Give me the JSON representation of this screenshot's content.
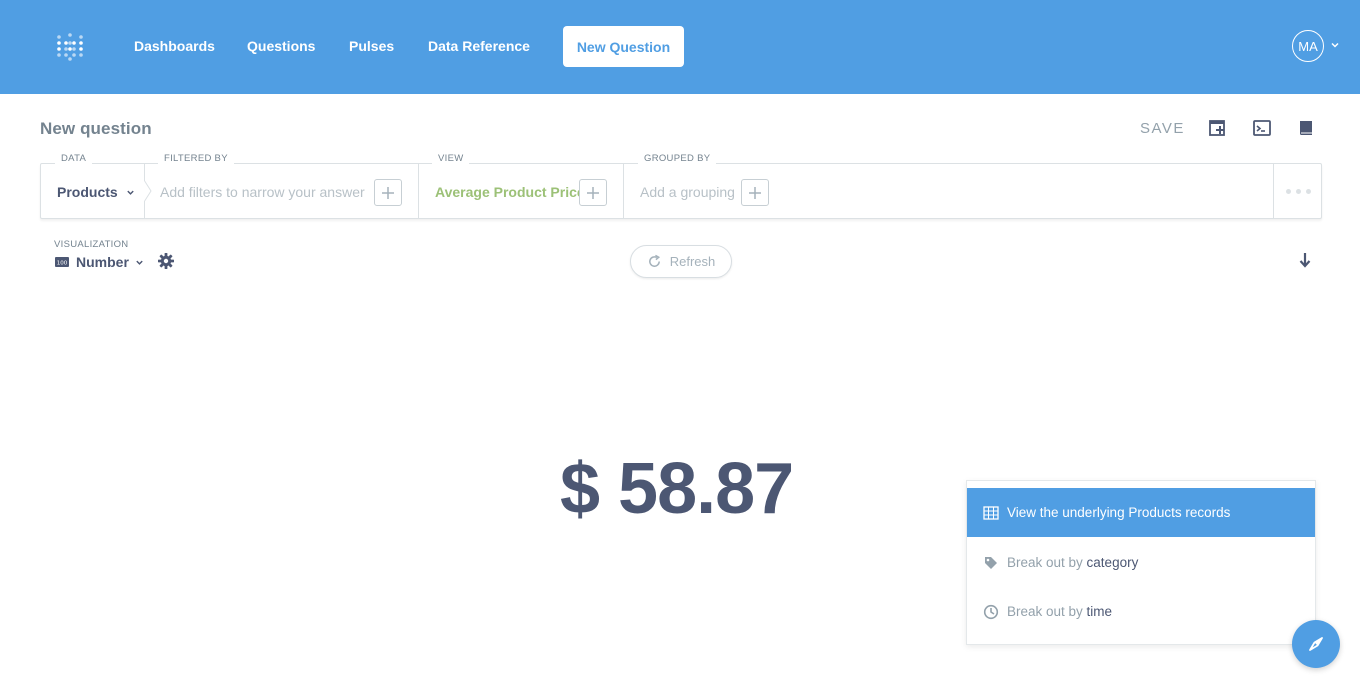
{
  "nav": {
    "items": [
      "Dashboards",
      "Questions",
      "Pulses",
      "Data Reference"
    ],
    "new_question": "New Question",
    "avatar_initials": "MA"
  },
  "header": {
    "title": "New question",
    "save_label": "SAVE"
  },
  "query_builder": {
    "data_label": "DATA",
    "data_value": "Products",
    "filter_label": "FILTERED BY",
    "filter_placeholder": "Add filters to narrow your answer",
    "view_label": "VIEW",
    "view_value": "Average Product Price",
    "group_label": "GROUPED BY",
    "group_placeholder": "Add a grouping"
  },
  "visualization": {
    "label": "VISUALIZATION",
    "type": "Number",
    "refresh_label": "Refresh"
  },
  "result": {
    "value": "$ 58.87"
  },
  "actions": {
    "items": [
      {
        "prefix": "View the underlying Products records",
        "strong": ""
      },
      {
        "prefix": "Break out by ",
        "strong": "category"
      },
      {
        "prefix": "Break out by ",
        "strong": "time"
      }
    ]
  },
  "colors": {
    "brand": "#509ee3",
    "metric_green": "#9cc177",
    "text_dark": "#4c5773",
    "text_light": "#93a1ab"
  }
}
